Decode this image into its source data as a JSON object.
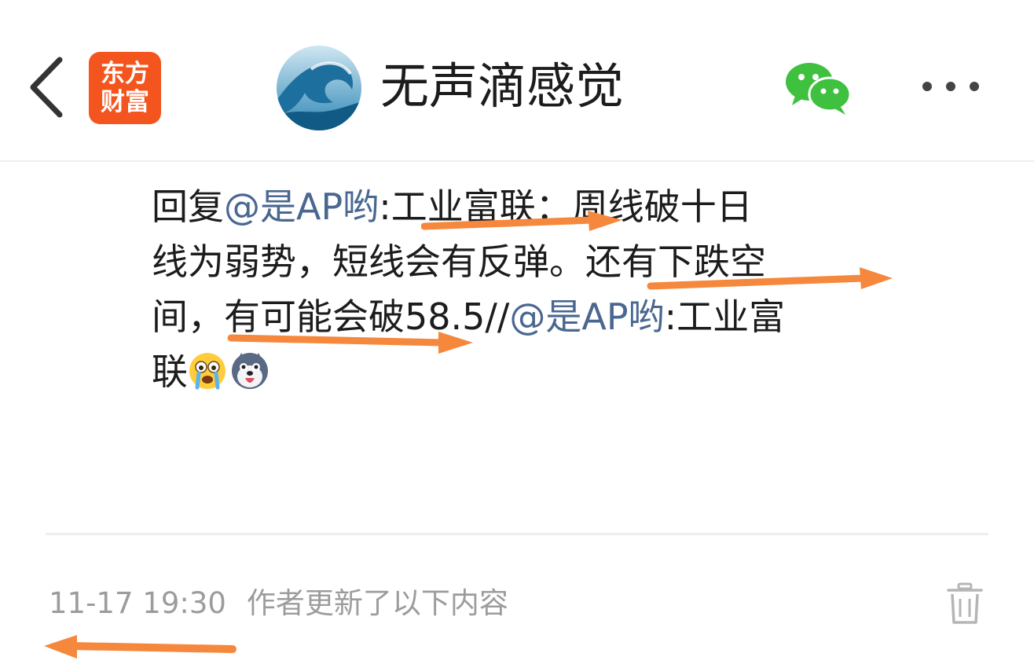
{
  "header": {
    "app_logo": {
      "line1": "东方",
      "line2": "财富",
      "color": "#f4541e"
    },
    "title": "无声滴感觉",
    "back_icon": "chevron-left-icon",
    "share_icon": "wechat-icon",
    "more_icon": "more-horizontal-icon"
  },
  "post": {
    "line1": {
      "prefix": "回复",
      "mention": "@是AP哟",
      "text": ":工业富联：周线破十日"
    },
    "line2": "线为弱势，短线会有反弹。还有下跌空",
    "line3": {
      "text": "间，有可能会破58.5//",
      "mention": "@是AP哟",
      "suffix": ":工业富"
    },
    "line4": {
      "text": "联"
    },
    "emojis": [
      "crying-face-emoji",
      "husky-dog-emoji"
    ]
  },
  "update": {
    "time": "11-17 19:30",
    "label": "作者更新了以下内容",
    "delete_icon": "trash-icon"
  },
  "annotations": {
    "color": "#f5883c",
    "count": 4
  },
  "colors": {
    "mention": "#4a6790",
    "meta": "#9c9c9c",
    "wechat_green": "#3fc03f"
  }
}
